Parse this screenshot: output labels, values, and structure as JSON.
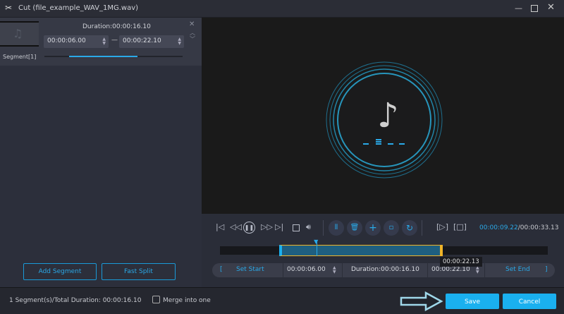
{
  "window": {
    "title": "Cut (file_example_WAV_1MG.wav)"
  },
  "segment": {
    "label": "Segment[1]",
    "duration": "Duration:00:00:16.10",
    "start": "00:00:06.00",
    "end": "00:00:22.10",
    "progress": 0.5
  },
  "left_buttons": {
    "add_segment": "Add Segment",
    "fast_split": "Fast Split"
  },
  "player": {
    "current_time": "00:00:09.22",
    "total_time": "/00:00:33.13"
  },
  "timeline": {
    "selection_start": 0.18,
    "selection_end": 0.68,
    "playhead": 0.295,
    "tooltip": "00:00:22.13"
  },
  "setbar": {
    "open_bracket": "[",
    "set_start": "Set Start",
    "start": "00:00:06.00",
    "duration": "Duration:00:00:16.10",
    "end": "00:00:22.10",
    "set_end": "Set End",
    "close_bracket": "]"
  },
  "footer": {
    "summary": "1 Segment(s)/Total Duration: 00:00:16.10",
    "merge_label": "Merge into one",
    "merge_checked": false,
    "save": "Save",
    "cancel": "Cancel"
  },
  "colors": {
    "accent": "#1ab0ef",
    "end_handle": "#f0b429"
  }
}
